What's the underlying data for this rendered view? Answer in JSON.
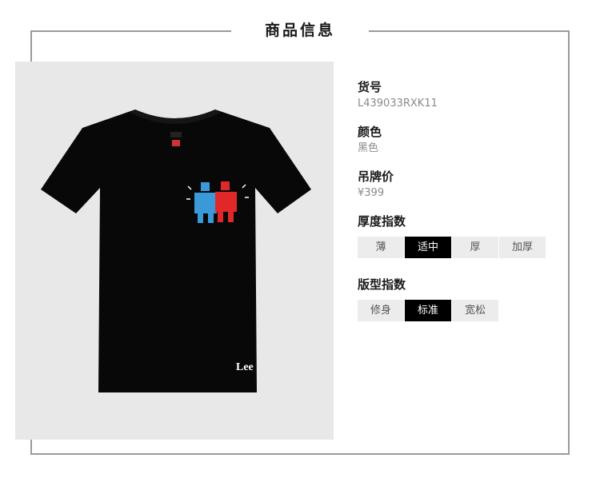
{
  "section": {
    "title": "商品信息"
  },
  "product": {
    "brand_mark": "Lee",
    "item_number_label": "货号",
    "item_number": "L439033RXK11",
    "color_label": "颜色",
    "color": "黑色",
    "price_label": "吊牌价",
    "price": "¥399"
  },
  "thickness": {
    "label": "厚度指数",
    "options": [
      "薄",
      "适中",
      "厚",
      "加厚"
    ],
    "selected": "适中"
  },
  "fit": {
    "label": "版型指数",
    "options": [
      "修身",
      "标准",
      "宽松"
    ],
    "selected": "标准"
  },
  "colors": {
    "frame": "#9a9a9a",
    "photo_bg": "#e8e8e8",
    "active": "#000000",
    "inactive": "#ececec"
  }
}
